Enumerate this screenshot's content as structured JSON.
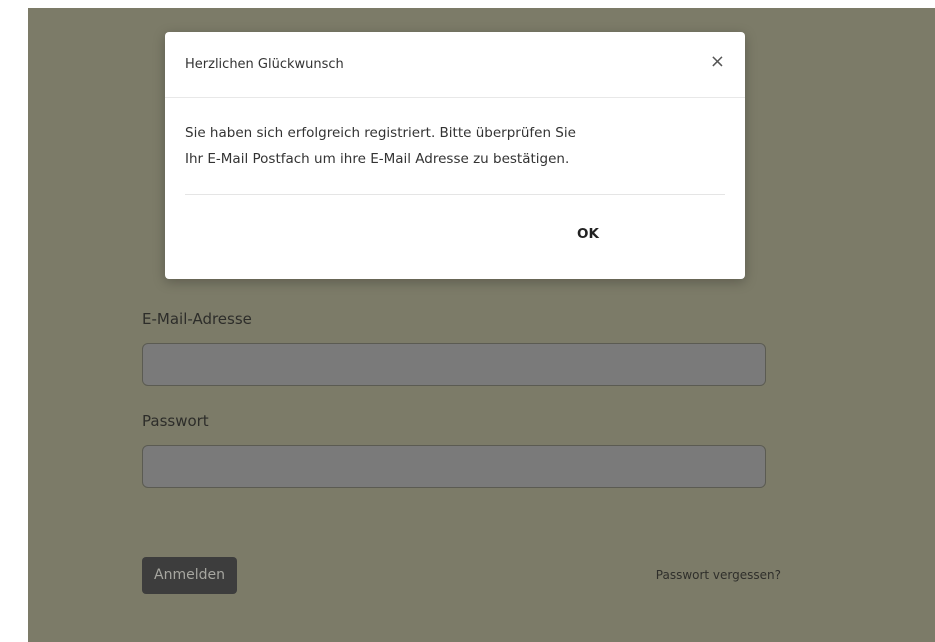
{
  "modal": {
    "title": "Herzlichen Glückwunsch",
    "close_glyph": "×",
    "message_line1": "Sie haben sich erfolgreich registriert. Bitte überprüfen Sie",
    "message_line2": "Ihr E-Mail Postfach um ihre E-Mail Adresse zu bestätigen.",
    "ok_label": "OK"
  },
  "login_form": {
    "email_label": "E-Mail-Adresse",
    "email_value": "",
    "password_label": "Passwort",
    "password_value": "",
    "submit_label": "Anmelden",
    "forgot_link": "Passwort vergessen?"
  },
  "colors": {
    "backdrop": "#7c7b68",
    "modal_background": "#ffffff",
    "input_background": "#7a7a7a",
    "button_background": "#3d3d3d"
  }
}
